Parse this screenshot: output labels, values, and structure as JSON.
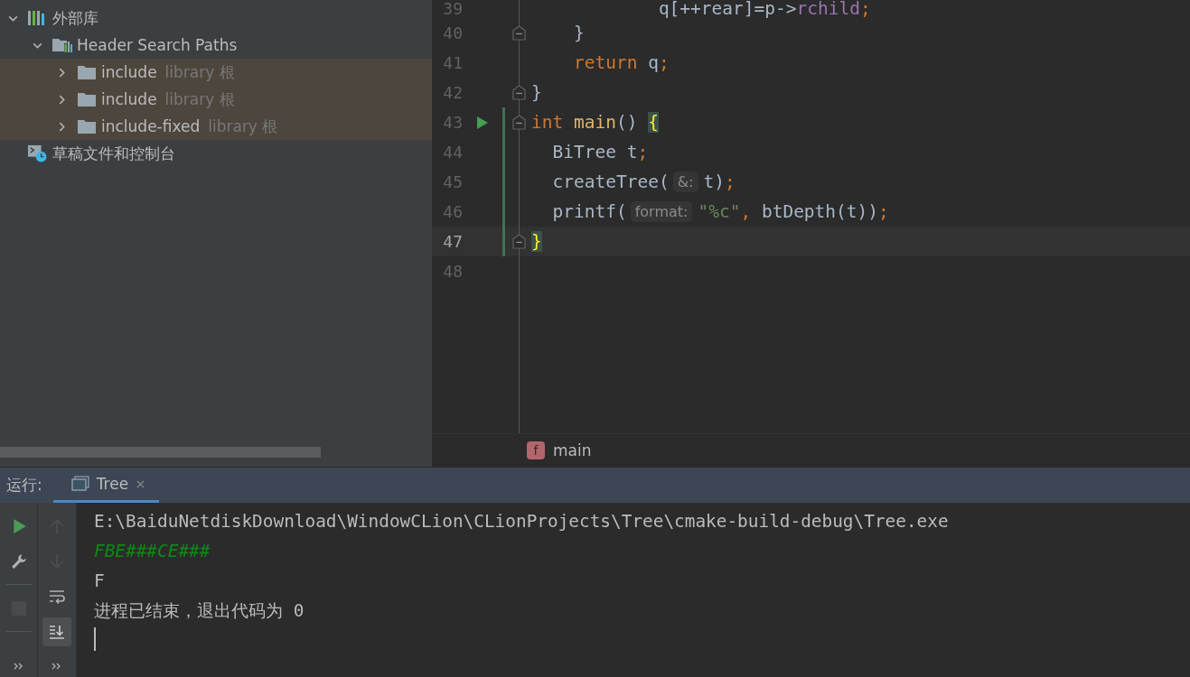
{
  "tree": [
    {
      "label": "外部库",
      "kind": "library",
      "expanded": true,
      "highlighted": false,
      "children": [
        {
          "label": "Header Search Paths",
          "kind": "header-paths",
          "expanded": true,
          "highlighted": false,
          "children": [
            {
              "label": "include",
              "hint": "library 根",
              "kind": "folder",
              "expanded": false,
              "highlighted": true
            },
            {
              "label": "include",
              "hint": "library 根",
              "kind": "folder",
              "expanded": false,
              "highlighted": true
            },
            {
              "label": "include-fixed",
              "hint": "library 根",
              "kind": "folder",
              "expanded": false,
              "highlighted": true
            }
          ]
        }
      ]
    },
    {
      "label": "草稿文件和控制台",
      "kind": "scratch",
      "highlighted": false
    }
  ],
  "editor": {
    "lines": [
      {
        "number": "39",
        "run": false,
        "fold": false,
        "changed": false,
        "current": false,
        "tokens": [
          {
            "text": "            q[++rear]=p->",
            "kind": "plain"
          },
          {
            "text": "rchild",
            "kind": "field"
          },
          {
            "text": ";",
            "kind": "punct"
          }
        ]
      },
      {
        "number": "40",
        "run": false,
        "fold": true,
        "changed": false,
        "current": false,
        "tokens": [
          {
            "text": "    }",
            "kind": "plain"
          }
        ]
      },
      {
        "number": "41",
        "run": false,
        "fold": false,
        "changed": false,
        "current": false,
        "tokens": [
          {
            "text": "    return",
            "kind": "keyword"
          },
          {
            "text": " q",
            "kind": "plain"
          },
          {
            "text": ";",
            "kind": "punct"
          }
        ]
      },
      {
        "number": "42",
        "run": false,
        "fold": true,
        "changed": false,
        "current": false,
        "tokens": [
          {
            "text": "}",
            "kind": "plain"
          }
        ]
      },
      {
        "number": "43",
        "run": true,
        "fold": true,
        "changed": true,
        "current": false,
        "tokens": [
          {
            "text": "int ",
            "kind": "keyword"
          },
          {
            "text": "main",
            "kind": "function"
          },
          {
            "text": "() ",
            "kind": "plain"
          },
          {
            "text": "{",
            "kind": "brace"
          }
        ]
      },
      {
        "number": "44",
        "run": false,
        "fold": false,
        "changed": true,
        "current": false,
        "tokens": [
          {
            "text": "  BiTree t",
            "kind": "plain"
          },
          {
            "text": ";",
            "kind": "punct"
          }
        ]
      },
      {
        "number": "45",
        "run": false,
        "fold": false,
        "changed": true,
        "current": false,
        "tokens": [
          {
            "text": "  createTree(",
            "kind": "plain"
          },
          {
            "text": "&:",
            "kind": "hint"
          },
          {
            "text": "t)",
            "kind": "plain"
          },
          {
            "text": ";",
            "kind": "punct"
          }
        ]
      },
      {
        "number": "46",
        "run": false,
        "fold": false,
        "changed": true,
        "current": false,
        "tokens": [
          {
            "text": "  printf(",
            "kind": "plain"
          },
          {
            "text": "format:",
            "kind": "hint"
          },
          {
            "text": "\"%c\"",
            "kind": "string"
          },
          {
            "text": ", ",
            "kind": "punct"
          },
          {
            "text": "btDepth(t))",
            "kind": "plain"
          },
          {
            "text": ";",
            "kind": "punct"
          }
        ]
      },
      {
        "number": "47",
        "run": false,
        "fold": true,
        "changed": true,
        "current": true,
        "tokens": [
          {
            "text": "}",
            "kind": "brace"
          }
        ]
      },
      {
        "number": "48",
        "run": false,
        "fold": false,
        "changed": false,
        "current": false
      }
    ]
  },
  "breadcrumb": {
    "icon": "f",
    "label": "main"
  },
  "run_panel": {
    "label": "运行:",
    "tabs": [
      {
        "label": "Tree",
        "selected": true
      }
    ],
    "toolbar_left": [
      {
        "kind": "run",
        "disabled": false
      },
      {
        "kind": "wrench",
        "disabled": false
      },
      {
        "kind": "separator"
      },
      {
        "kind": "stop",
        "disabled": true
      },
      {
        "kind": "separator"
      },
      {
        "kind": "more",
        "disabled": false
      }
    ],
    "toolbar_right": [
      {
        "kind": "up",
        "disabled": true,
        "selected": false
      },
      {
        "kind": "down",
        "disabled": true,
        "selected": false
      },
      {
        "kind": "wrap",
        "disabled": false,
        "selected": false
      },
      {
        "kind": "scroll-end",
        "disabled": false,
        "selected": true
      },
      {
        "kind": "more",
        "disabled": false,
        "selected": false
      }
    ],
    "console": [
      {
        "text": "E:\\BaiduNetdiskDownload\\WindowCLion\\CLionProjects\\Tree\\cmake-build-debug\\Tree.exe",
        "kind": "system"
      },
      {
        "text": "FBE###CE###",
        "kind": "input"
      },
      {
        "text": "F",
        "kind": "output"
      },
      {
        "text": "进程已结束，退出代码为 0",
        "kind": "system"
      }
    ]
  }
}
